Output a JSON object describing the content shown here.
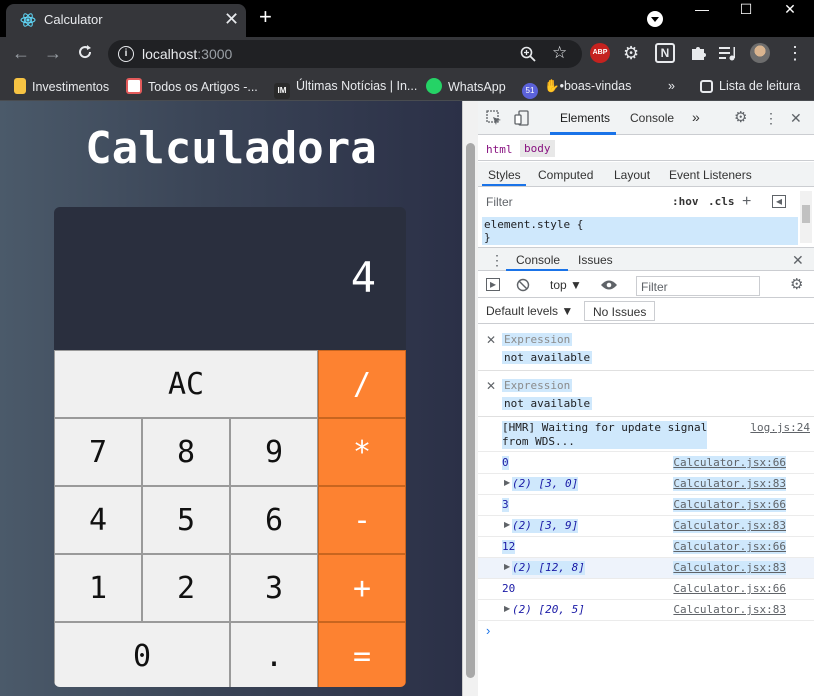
{
  "browser": {
    "tab_title": "Calculator",
    "tab_close": "✕",
    "new_tab": "+",
    "url_host": "localhost",
    "url_port": ":3000",
    "bookmarks": [
      "Investimentos",
      "Todos os Artigos -...",
      "Últimas Notícias | In...",
      "WhatsApp",
      "•boas-vindas",
      "Lista de leitura"
    ],
    "bookmark_overflow": "»",
    "window_controls": [
      "—",
      "☐",
      "✕"
    ]
  },
  "app": {
    "title": "Calculadora",
    "display_value": "4",
    "keys": {
      "ac": "AC",
      "divide": "/",
      "seven": "7",
      "eight": "8",
      "nine": "9",
      "multiply": "*",
      "four": "4",
      "five": "5",
      "six": "6",
      "minus": "-",
      "one": "1",
      "two": "2",
      "three": "3",
      "plus": "+",
      "zero": "0",
      "dot": ".",
      "equals": "="
    }
  },
  "devtools": {
    "tabs": [
      "Elements",
      "Console"
    ],
    "more_tabs": "»",
    "breadcrumb": [
      "html",
      "body"
    ],
    "styles_tabs": [
      "Styles",
      "Computed",
      "Layout",
      "Event Listeners"
    ],
    "filter_placeholder": "Filter",
    "hov": ":hov",
    "cls": ".cls",
    "element_style_line1": "element.style {",
    "element_style_line2": "}",
    "drawer_tabs": [
      "Console",
      "Issues"
    ],
    "context": "top",
    "console_filter_placeholder": "Filter",
    "default_levels": "Default levels ▼",
    "no_issues": "No Issues",
    "expressions": [
      {
        "label": "Expression",
        "value": "not available"
      },
      {
        "label": "Expression",
        "value": "not available"
      }
    ],
    "hmr": {
      "text1": "[HMR] Waiting for update signal",
      "text2": "from WDS...",
      "src": "log.js:24"
    },
    "logs": [
      {
        "text": "0",
        "src": "Calculator.jsx:66"
      },
      {
        "text": "(2) [3, 0]",
        "src": "Calculator.jsx:83"
      },
      {
        "text": "3",
        "src": "Calculator.jsx:66"
      },
      {
        "text": "(2) [3, 9]",
        "src": "Calculator.jsx:83"
      },
      {
        "text": "12",
        "src": "Calculator.jsx:66"
      },
      {
        "text": "(2) [12, 8]",
        "src": "Calculator.jsx:83"
      },
      {
        "text": "20",
        "src": "Calculator.jsx:66"
      },
      {
        "text": "(2) [20, 5]",
        "src": "Calculator.jsx:83"
      }
    ],
    "prompt": "›"
  }
}
